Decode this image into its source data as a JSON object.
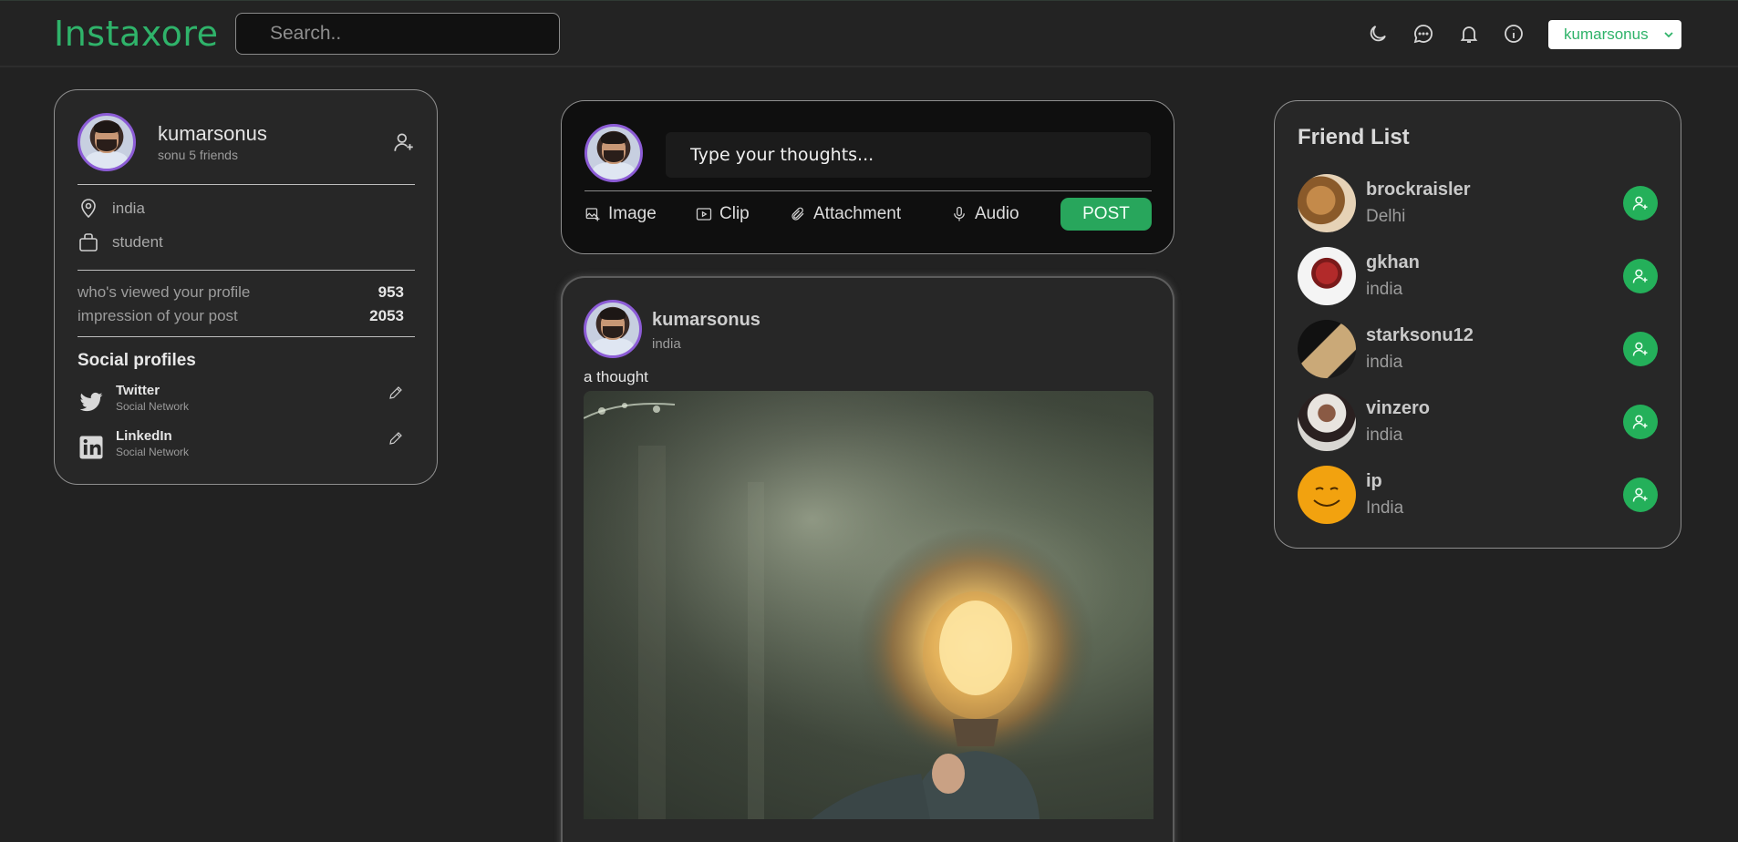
{
  "header": {
    "logo": "Instaxore",
    "search_placeholder": "Search..",
    "user_select": "kumarsonus",
    "icons": [
      "moon-icon",
      "chat-icon",
      "bell-icon",
      "info-icon"
    ]
  },
  "profile": {
    "name": "kumarsonus",
    "subtitle": "sonu 5 friends",
    "location": "india",
    "occupation": "student",
    "stats": [
      {
        "label": "who's viewed your profile",
        "value": "953"
      },
      {
        "label": "impression of your post",
        "value": "2053"
      }
    ],
    "social_title": "Social profiles",
    "socials": [
      {
        "name": "Twitter",
        "type": "Social Network"
      },
      {
        "name": "LinkedIn",
        "type": "Social Network"
      }
    ]
  },
  "composer": {
    "placeholder": "Type your thoughts...",
    "actions": [
      "Image",
      "Clip",
      "Attachment",
      "Audio"
    ],
    "post_label": "POST"
  },
  "post": {
    "author": "kumarsonus",
    "location": "india",
    "text": "a thought"
  },
  "friends": {
    "title": "Friend List",
    "items": [
      {
        "name": "brockraisler",
        "location": "Delhi"
      },
      {
        "name": "gkhan",
        "location": "india"
      },
      {
        "name": "starksonu12",
        "location": "india"
      },
      {
        "name": "vinzero",
        "location": "india"
      },
      {
        "name": "ip",
        "location": "India"
      }
    ]
  },
  "colors": {
    "accent": "#2fb36a",
    "button": "#28a65c",
    "background": "#222222"
  }
}
